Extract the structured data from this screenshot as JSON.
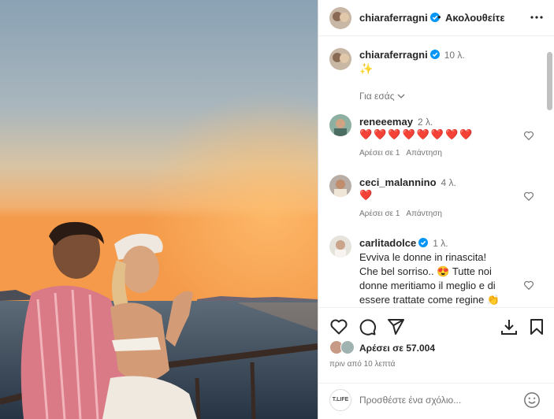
{
  "post": {
    "author": "chiaraferragni",
    "follow_state": "Ακολουθείτε",
    "caption": "✨",
    "caption_time": "10 λ.",
    "for_you": "Για εσάς"
  },
  "comments": [
    {
      "user": "reneeemay",
      "time": "2 λ.",
      "text": "❤️❤️❤️❤️❤️❤️❤️❤️",
      "likes": "Αρέσει σε 1",
      "reply": "Απάντηση"
    },
    {
      "user": "ceci_malannino",
      "time": "4 λ.",
      "text": "❤️",
      "likes": "Αρέσει σε 1",
      "reply": "Απάντηση"
    },
    {
      "user": "carlitadolce",
      "time": "1 λ.",
      "lines": [
        "Evviva le donne in rinascita!",
        "Che bel sorriso.. 😍 Tutte noi",
        "donne meritiamo il meglio e di",
        "essere trattate come regine 👏"
      ]
    }
  ],
  "footer": {
    "likes": "Αρέσει σε 57.004",
    "posted": "πριν από 10 λεπτά",
    "comment_placeholder": "Προσθέστε ένα σχόλιο...",
    "composer_avatar": "T.LIFE"
  },
  "icons": {
    "more": "more-options-icon",
    "like": "heart-icon",
    "comment": "comment-icon",
    "share": "share-icon",
    "download": "download-icon",
    "save": "bookmark-icon",
    "emoji": "emoji-icon",
    "verified": "verified-badge-icon"
  },
  "colors": {
    "verified": "#0095f6",
    "heart": "#e0245e"
  }
}
